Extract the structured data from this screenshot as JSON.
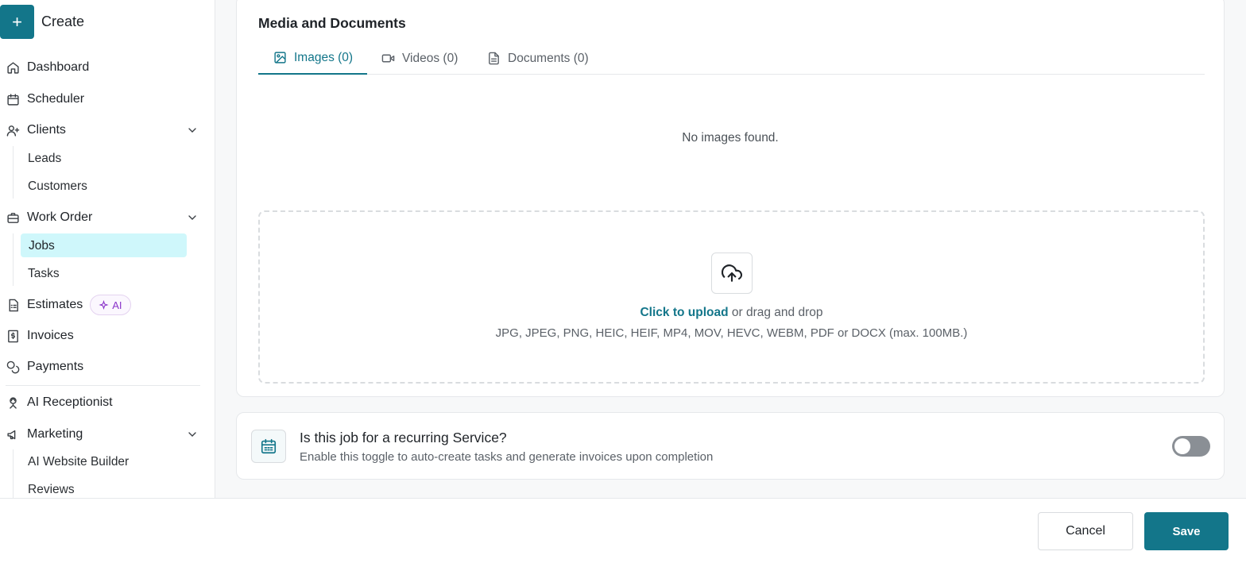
{
  "sidebar": {
    "create_label": "Create",
    "create_icon": "plus-icon",
    "items": {
      "dashboard": "Dashboard",
      "scheduler": "Scheduler",
      "clients": "Clients",
      "leads": "Leads",
      "customers": "Customers",
      "work_order": "Work Order",
      "jobs": "Jobs",
      "tasks": "Tasks",
      "estimates": "Estimates",
      "estimates_badge": "AI",
      "invoices": "Invoices",
      "payments": "Payments",
      "ai_receptionist": "AI Receptionist",
      "marketing": "Marketing",
      "ai_website_builder": "AI Website Builder",
      "reviews": "Reviews"
    },
    "active_item": "Jobs"
  },
  "media": {
    "title": "Media and Documents",
    "tabs": [
      {
        "label": "Images (0)",
        "icon": "image-icon",
        "active": true
      },
      {
        "label": "Videos (0)",
        "icon": "video-icon",
        "active": false
      },
      {
        "label": "Documents (0)",
        "icon": "document-icon",
        "active": false
      }
    ],
    "empty_message": "No images found.",
    "upload_link": "Click to upload",
    "upload_rest": " or drag and drop",
    "formats": "JPG, JPEG, PNG, HEIC, HEIF, MP4, MOV, HEVC, WEBM, PDF or DOCX (max. 100MB.)"
  },
  "recurring": {
    "title": "Is this job for a recurring Service?",
    "subtitle": "Enable this toggle to auto-create tasks and generate invoices upon completion",
    "enabled": false
  },
  "footer": {
    "cancel_label": "Cancel",
    "save_label": "Save"
  },
  "colors": {
    "accent": "#13768a",
    "active_bg": "#cff7fb",
    "ai_badge": "#8a33c9"
  }
}
